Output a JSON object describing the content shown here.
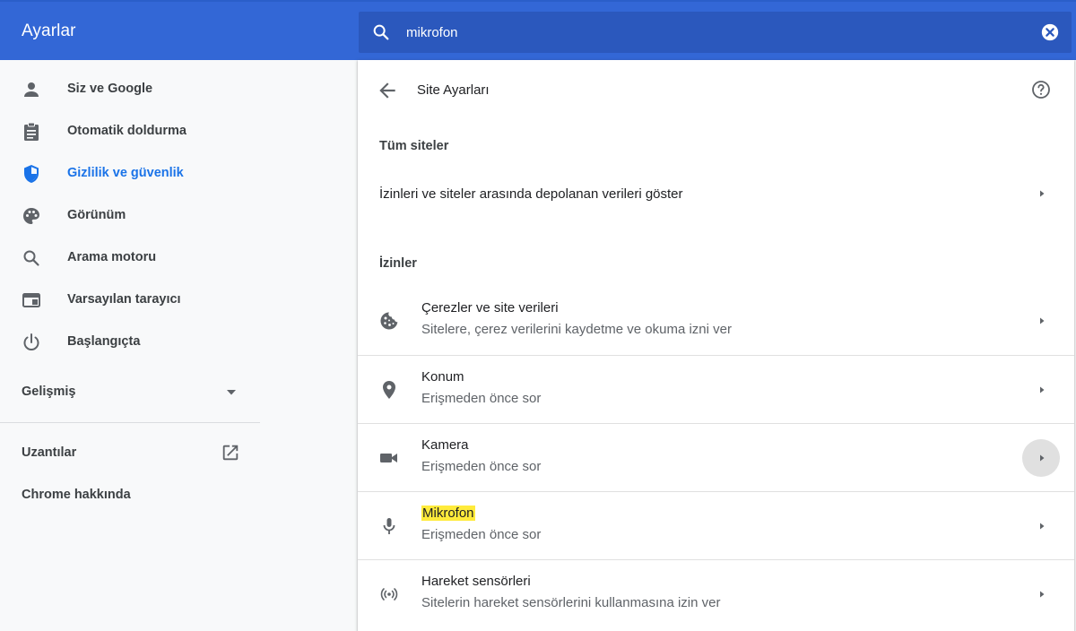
{
  "header": {
    "title": "Ayarlar",
    "search_value": "mikrofon",
    "search_icon": "search-icon",
    "clear_icon": "clear-search-icon"
  },
  "sidebar": {
    "items": [
      {
        "label": "Siz ve Google",
        "icon": "person-icon"
      },
      {
        "label": "Otomatik doldurma",
        "icon": "clipboard-icon"
      },
      {
        "label": "Gizlilik ve güvenlik",
        "icon": "shield-icon",
        "active": true
      },
      {
        "label": "Görünüm",
        "icon": "palette-icon"
      },
      {
        "label": "Arama motoru",
        "icon": "search-icon"
      },
      {
        "label": "Varsayılan tarayıcı",
        "icon": "browser-window-icon"
      },
      {
        "label": "Başlangıçta",
        "icon": "power-icon"
      }
    ],
    "advanced_label": "Gelişmiş",
    "extensions_label": "Uzantılar",
    "about_label": "Chrome hakkında"
  },
  "main": {
    "page_title": "Site Ayarları",
    "all_sites_heading": "Tüm siteler",
    "all_sites_row": "İzinleri ve siteler arasında depolanan verileri göster",
    "permissions_heading": "İzinler",
    "permissions": [
      {
        "title": "Çerezler ve site verileri",
        "subtitle": "Sitelere, çerez verilerini kaydetme ve okuma izni ver",
        "icon": "cookie-icon"
      },
      {
        "title": "Konum",
        "subtitle": "Erişmeden önce sor",
        "icon": "location-pin-icon"
      },
      {
        "title": "Kamera",
        "subtitle": "Erişmeden önce sor",
        "icon": "camera-icon"
      },
      {
        "title": "Mikrofon",
        "subtitle": "Erişmeden önce sor",
        "icon": "microphone-icon",
        "highlighted": true
      },
      {
        "title": "Hareket sensörleri",
        "subtitle": "Sitelerin hareket sensörlerini kullanmasına izin ver",
        "icon": "motion-sensor-icon"
      }
    ]
  },
  "colors": {
    "header_bg": "#3367d6",
    "accent": "#1a73e8",
    "highlight": "#ffeb3b"
  }
}
